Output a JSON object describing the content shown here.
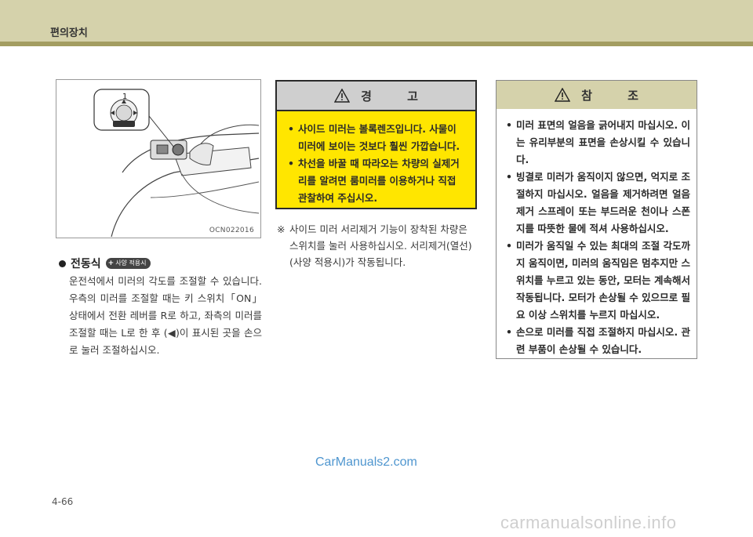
{
  "header": {
    "title": "편의장치"
  },
  "figure": {
    "callout_number": "1",
    "code": "OCN022016"
  },
  "left": {
    "section_title": "전동식",
    "option_badge": "사양 적용시",
    "body": "운전석에서 미러의 각도를 조절할 수 있습니다. 우측의 미러를 조절할 때는 키 스위치「ON」상태에서 전환 레버를 R로 하고, 좌측의 미러를 조절할 때는 L로 한 후 (◀)이 표시된 곳을 손으로 눌러 조절하십시오."
  },
  "warning": {
    "title": "경  고",
    "items": [
      "사이드 미러는 볼록렌즈입니다. 사물이 미러에 보이는 것보다 훨씬 가깝습니다.",
      "차선을 바꿀 때 따라오는 차량의 실제거리를 알려면 룸미러를 이용하거나 직접 관찰하여 주십시오."
    ]
  },
  "note": {
    "mark": "※",
    "text": "사이드 미러 서리제거 기능이 장착된 차량은 스위치를 눌러 사용하십시오. 서리제거(열선)(사양 적용시)가 작동됩니다."
  },
  "reference": {
    "title": "참  조",
    "items": [
      "미러 표면의 얼음을 긁어내지 마십시오. 이는 유리부분의 표면을 손상시킬 수 있습니다.",
      "빙결로 미러가 움직이지 않으면, 억지로 조절하지 마십시오. 얼음을 제거하려면 얼음제거 스프레이 또는 부드러운 천이나 스폰지를 따뜻한 물에 적셔 사용하십시오.",
      "미러가 움직일 수 있는 최대의 조절 각도까지 움직이면, 미러의 움직임은 멈추지만 스위치를 누르고 있는 동안, 모터는 계속해서 작동됩니다. 모터가 손상될 수 있으므로 필요 이상 스위치를 누르지 마십시오.",
      "손으로 미러를 직접 조절하지 마십시오. 관련 부품이 손상될 수 있습니다."
    ]
  },
  "watermark": "CarManuals2.com",
  "page_number": "4-66",
  "footer_watermark": "carmanualsonline.info",
  "colors": {
    "header_bg": "#d5d2ab",
    "header_rule": "#a39d61",
    "warning_bg": "#ffe600",
    "warning_head_bg": "#cfcfcf",
    "reference_head_bg": "#d5d2ab"
  }
}
